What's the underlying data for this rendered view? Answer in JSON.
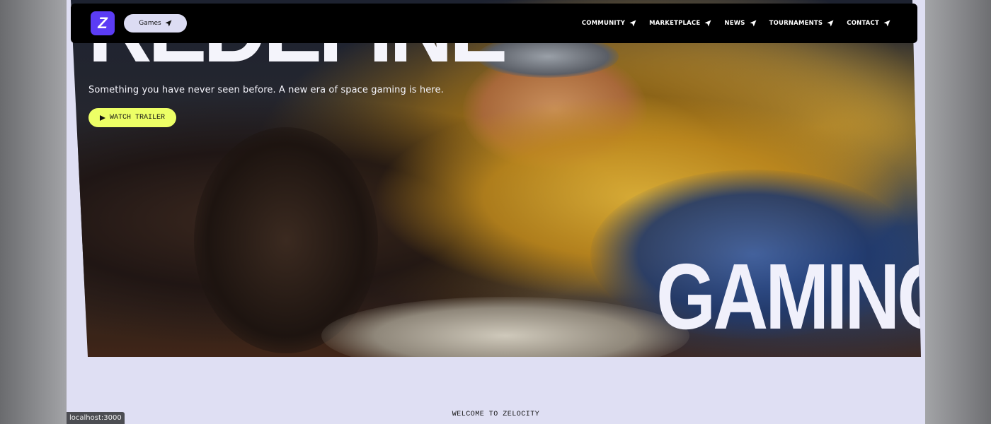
{
  "navbar": {
    "logo_glyph": "Z",
    "games_label": "Games",
    "links": [
      {
        "label": "COMMUNITY"
      },
      {
        "label": "MARKETPLACE"
      },
      {
        "label": "NEWS"
      },
      {
        "label": "TOURNAMENTS"
      },
      {
        "label": "CONTACT"
      }
    ]
  },
  "hero": {
    "headline_top": "REDEFINE",
    "tagline": "Something you have never seen before. A new era of space gaming is here.",
    "watch_trailer_label": "WATCH TRAILER",
    "headline_bottom": "GAMING"
  },
  "section": {
    "welcome_label": "WELCOME TO ZELOCITY"
  },
  "status_bar": {
    "url": "localhost:3000"
  },
  "colors": {
    "accent_yellow": "#edff66",
    "logo_purple": "#5b3cf5",
    "page_bg": "#dfdff3",
    "navbar_bg": "#000000"
  },
  "icons": {
    "nav_arrow": "navigation-arrow-icon",
    "play": "play-icon"
  }
}
